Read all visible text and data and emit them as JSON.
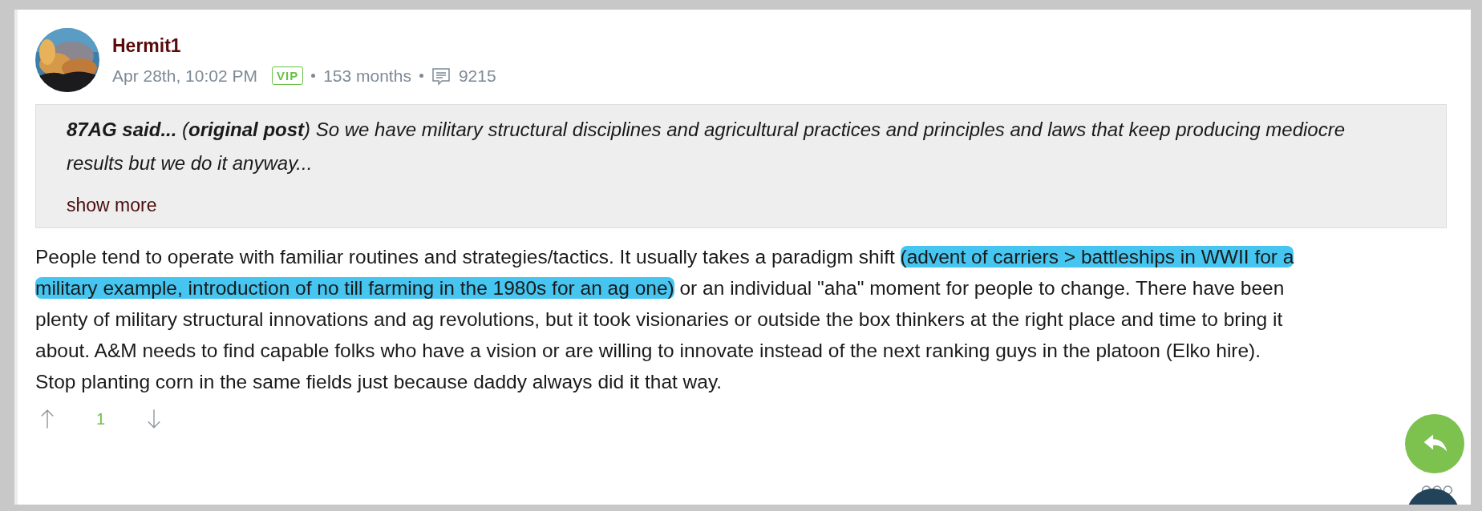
{
  "post": {
    "author": "Hermit1",
    "timestamp": "Apr 28th, 10:02 PM",
    "badge": "VIP",
    "tenure": "153 months",
    "post_count": "9215",
    "quote": {
      "text": "**87AG said...** (**original post**) So we have military structural disciplines and agricultural practices and principles and laws that keep producing mediocre results but we do it anyway...",
      "show_more": "show more"
    },
    "body": [
      {
        "segments": [
          {
            "text": "People tend to operate with familiar routines and strategies/tactics. It usually takes a paradigm shift ",
            "highlighted": false
          },
          {
            "text": "(advent of carriers > battleships in WWII for a",
            "highlighted": true
          }
        ]
      },
      {
        "segments": [
          {
            "text": "military example, introduction of no till farming in the 1980s for an ag one)",
            "highlighted": true
          },
          {
            "text": " or an individual \"aha\" moment for people to change. There have been",
            "highlighted": false
          }
        ]
      },
      {
        "segments": [
          {
            "text": "plenty of military structural innovations and ag revolutions, but it took visionaries or outside the box thinkers at the right place and time to bring it",
            "highlighted": false
          }
        ]
      },
      {
        "segments": [
          {
            "text": "about. A&M needs to find capable folks who have a vision or are willing to innovate instead of the next ranking guys in the platoon (Elko hire).",
            "highlighted": false
          }
        ]
      },
      {
        "segments": [
          {
            "text": "Stop planting corn in the same fields just because daddy always did it that way.",
            "highlighted": false
          }
        ]
      }
    ],
    "votes": {
      "score": "1"
    }
  }
}
